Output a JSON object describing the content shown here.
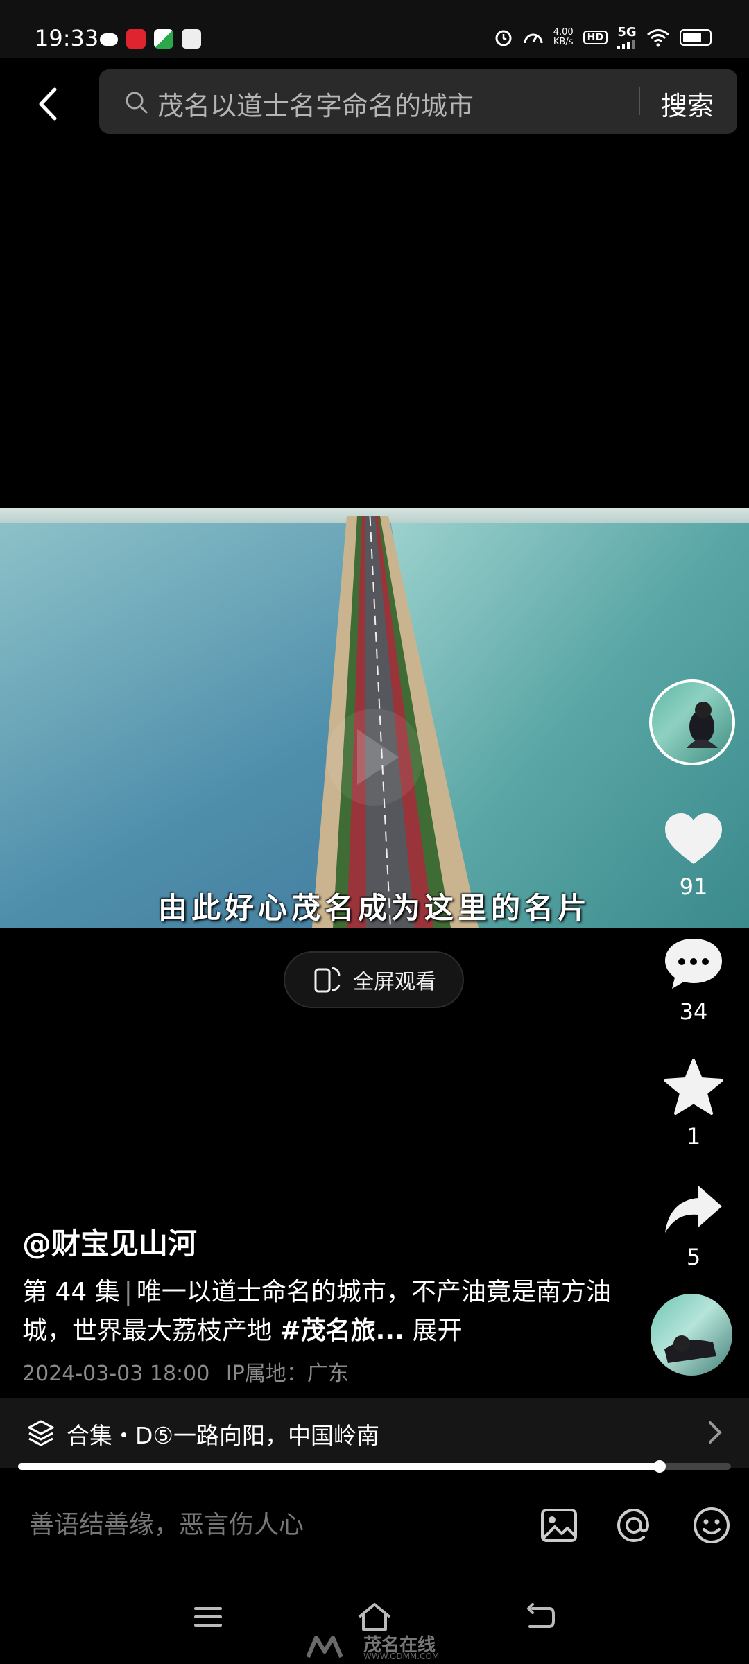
{
  "status_bar": {
    "time": "19:33",
    "speed_value": "4.00",
    "speed_unit": "KB/s",
    "hd": "HD",
    "network": "5G"
  },
  "search": {
    "query": "茂名以道士名字命名的城市",
    "button_label": "搜索"
  },
  "video": {
    "subtitle": "由此好心茂名成为这里的名片",
    "fullscreen_label": "全屏观看"
  },
  "rail": {
    "likes": "91",
    "comments": "34",
    "favorites": "1",
    "shares": "5"
  },
  "post": {
    "author": "@财宝见山河",
    "episode": "第 44 集",
    "description": "唯一以道士命名的城市，不产油竟是南方油城，世界最大荔枝产地",
    "hashtag": "#茂名旅...",
    "expand_label": "展开",
    "date": "2024-03-03 18:00",
    "ip_location": "IP属地：广东"
  },
  "collection": {
    "label": "合集・D⑤一路向阳，中国岭南"
  },
  "playback": {
    "progress": 0.9
  },
  "comment": {
    "placeholder": "善语结善缘，恶言伤人心"
  },
  "watermark": {
    "text": "茂名在线",
    "site": "WWW.GDMM.COM"
  }
}
